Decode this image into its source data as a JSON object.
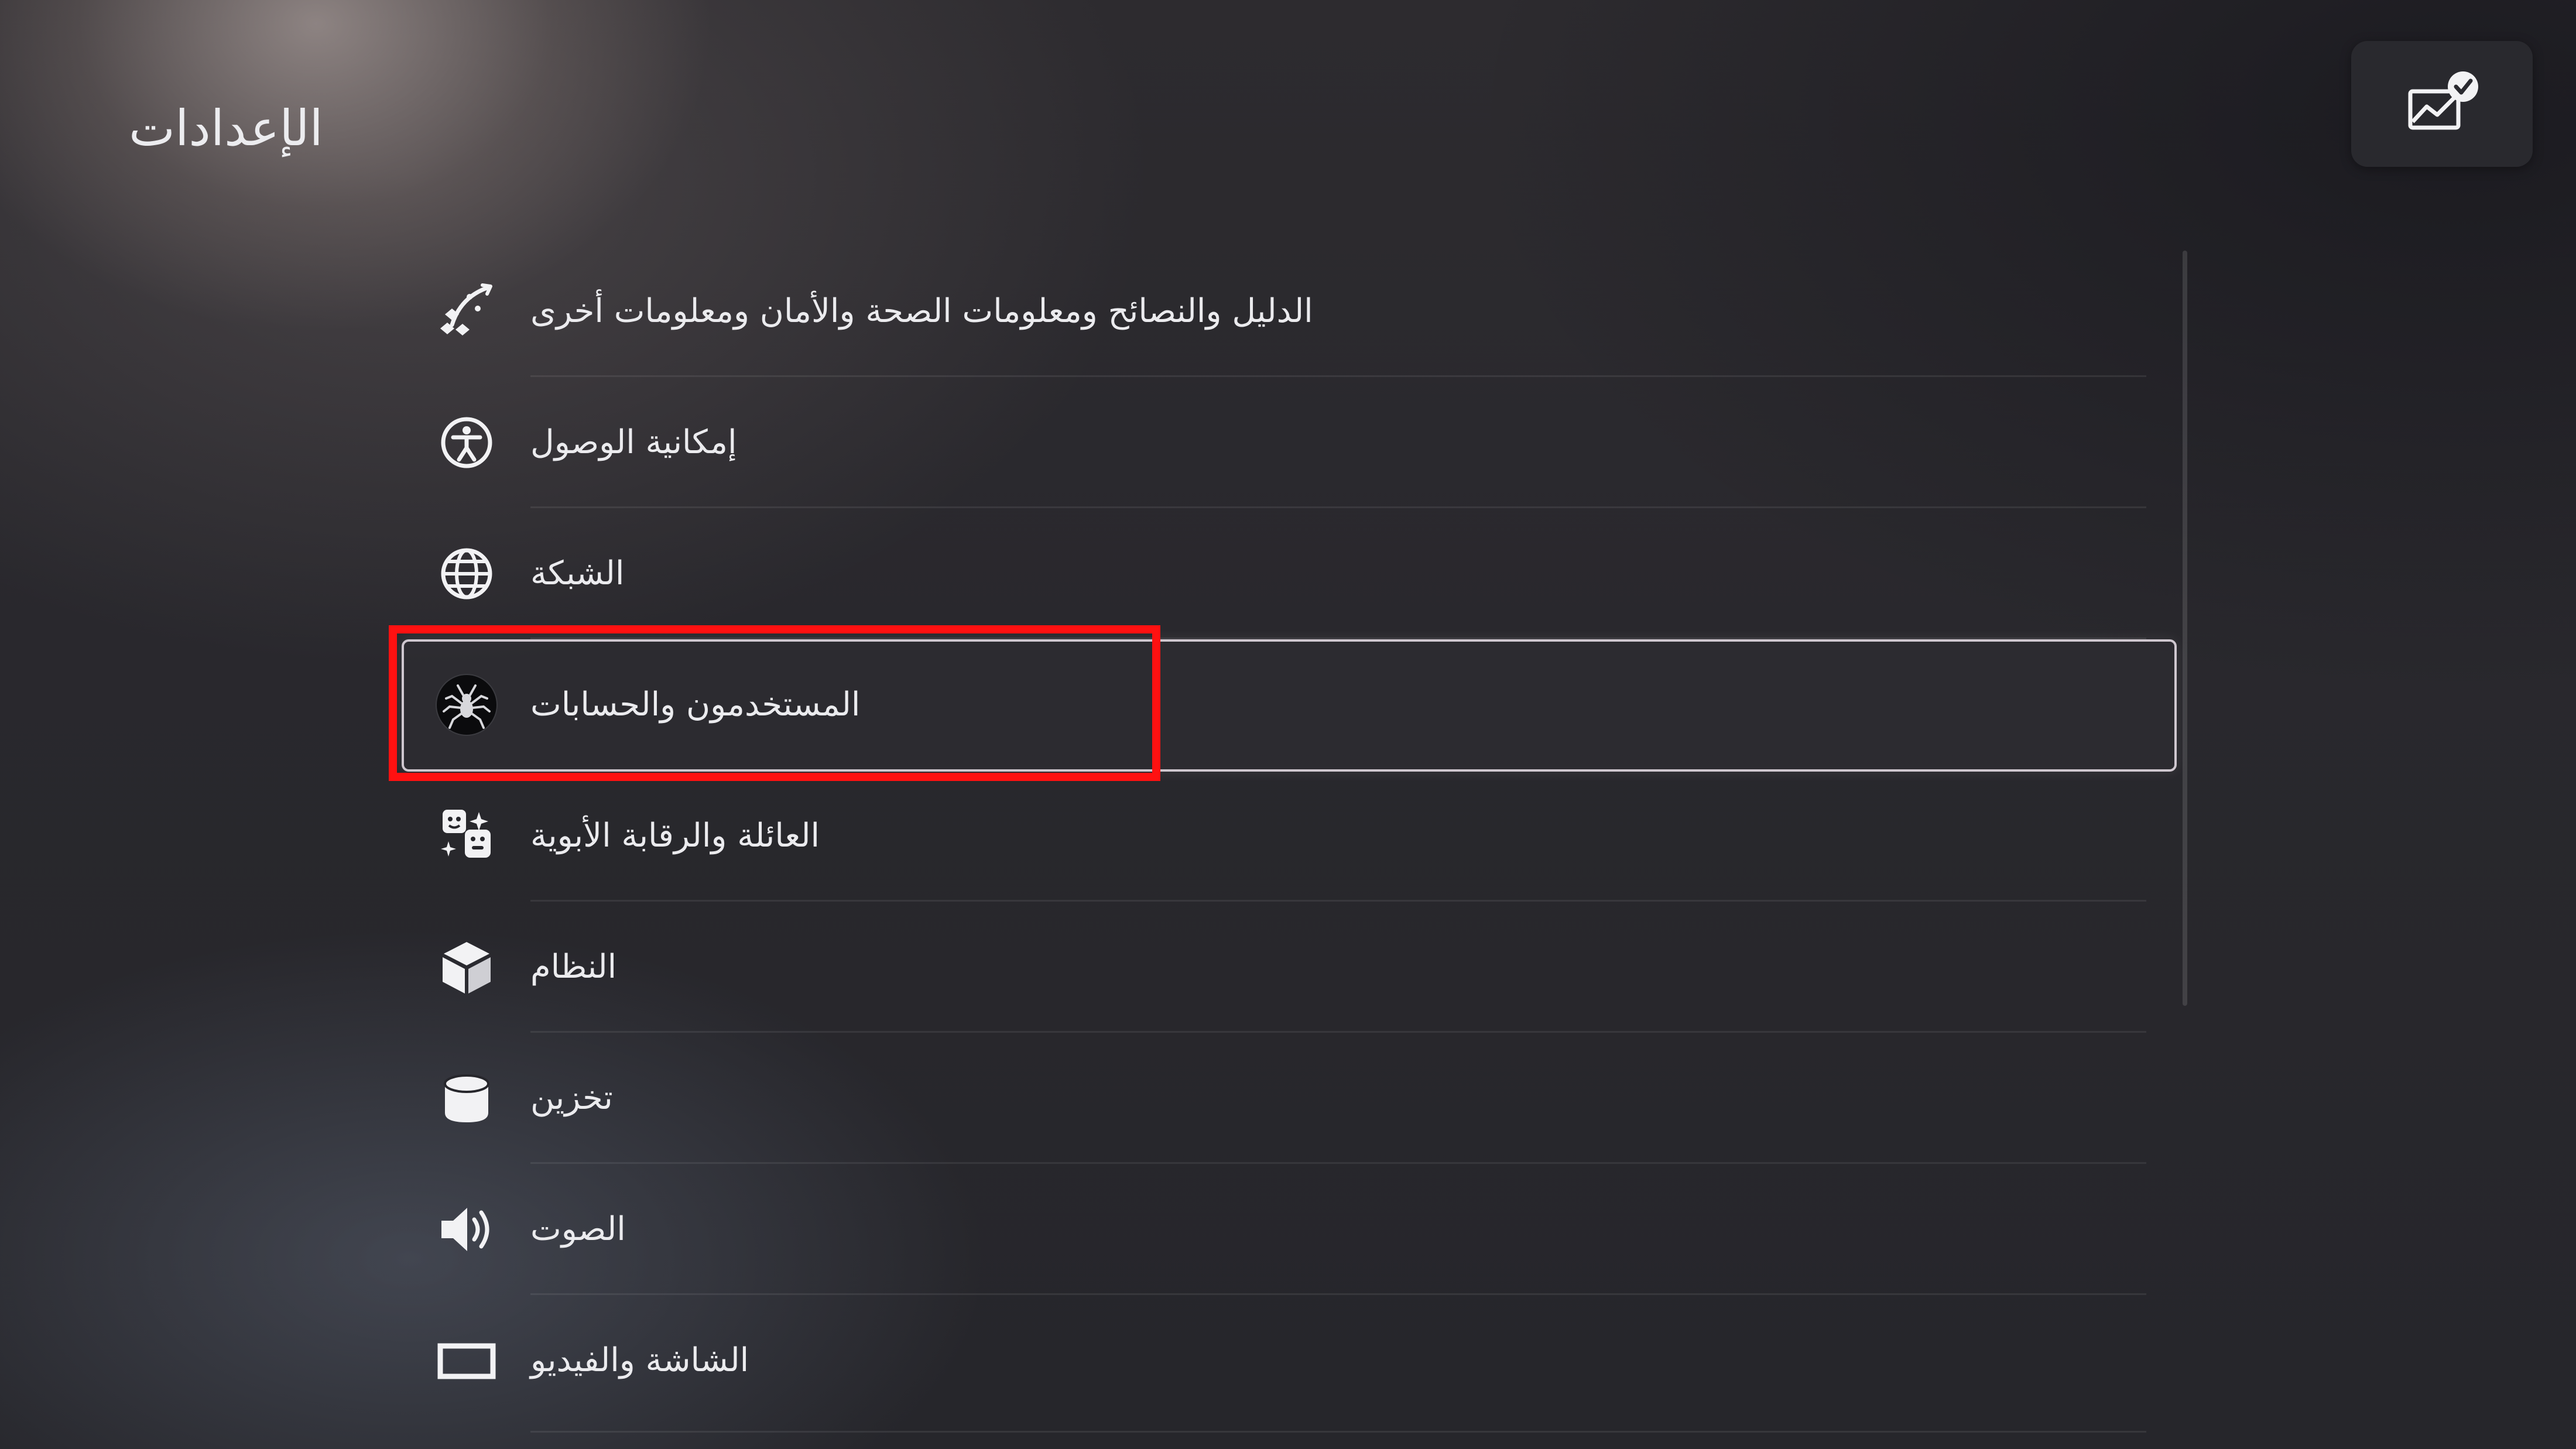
{
  "page": {
    "title": "الإعدادات"
  },
  "status_button": {
    "icon": "trophy-chart-check-icon"
  },
  "menu": {
    "items": [
      {
        "label": "الدليل والنصائح ومعلومات الصحة والأمان ومعلومات أخرى",
        "icon": "guide-icon"
      },
      {
        "label": "إمكانية الوصول",
        "icon": "accessibility-icon"
      },
      {
        "label": "الشبكة",
        "icon": "globe-icon"
      },
      {
        "label": "المستخدمون والحسابات",
        "icon": "user-avatar-icon",
        "selected": true
      },
      {
        "label": "العائلة والرقابة الأبوية",
        "icon": "family-icon"
      },
      {
        "label": "النظام",
        "icon": "cube-icon"
      },
      {
        "label": "تخزين",
        "icon": "storage-icon"
      },
      {
        "label": "الصوت",
        "icon": "speaker-icon"
      },
      {
        "label": "الشاشة والفيديو",
        "icon": "display-icon"
      }
    ]
  },
  "colors": {
    "highlight": "#ff1111",
    "focus_frame": "#cfc7cf",
    "text": "#ebebee"
  }
}
